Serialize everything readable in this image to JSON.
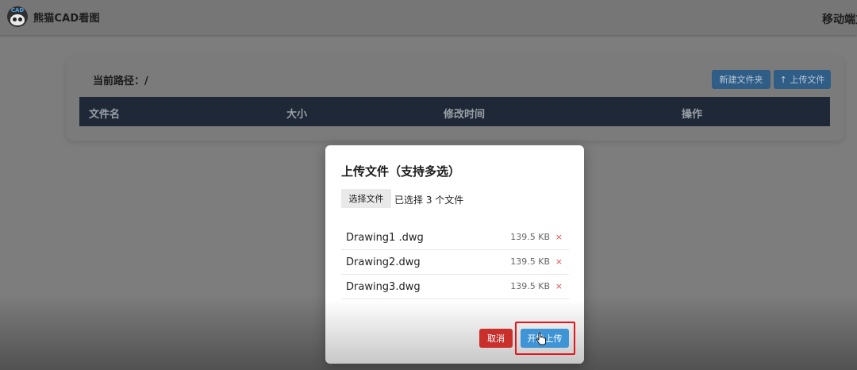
{
  "app": {
    "title": "熊猫CAD看图",
    "logo_text": "CAD",
    "mobile_link": "移动端文"
  },
  "panel": {
    "path_label": "当前路径：/",
    "new_folder_label": "新建文件夹",
    "upload_label": "↑ 上传文件",
    "columns": [
      "文件名",
      "大小",
      "修改时间",
      "操作"
    ]
  },
  "modal": {
    "title": "上传文件（支持多选）",
    "choose_label": "选择文件",
    "choose_status": "已选择 3 个文件",
    "files": [
      {
        "name": "Drawing1 .dwg",
        "size": "139.5 KB",
        "remove": "×"
      },
      {
        "name": "Drawing2.dwg",
        "size": "139.5 KB",
        "remove": "×"
      },
      {
        "name": "Drawing3.dwg",
        "size": "139.5 KB",
        "remove": "×"
      }
    ],
    "cancel_label": "取消",
    "start_label": "开始上传"
  },
  "colors": {
    "accent_blue": "#3f94d6",
    "danger_red": "#c9302c",
    "table_header": "#1f2836",
    "highlight": "#e8141b"
  },
  "icons": [
    "panda-logo-icon",
    "pointer-cursor-icon"
  ]
}
